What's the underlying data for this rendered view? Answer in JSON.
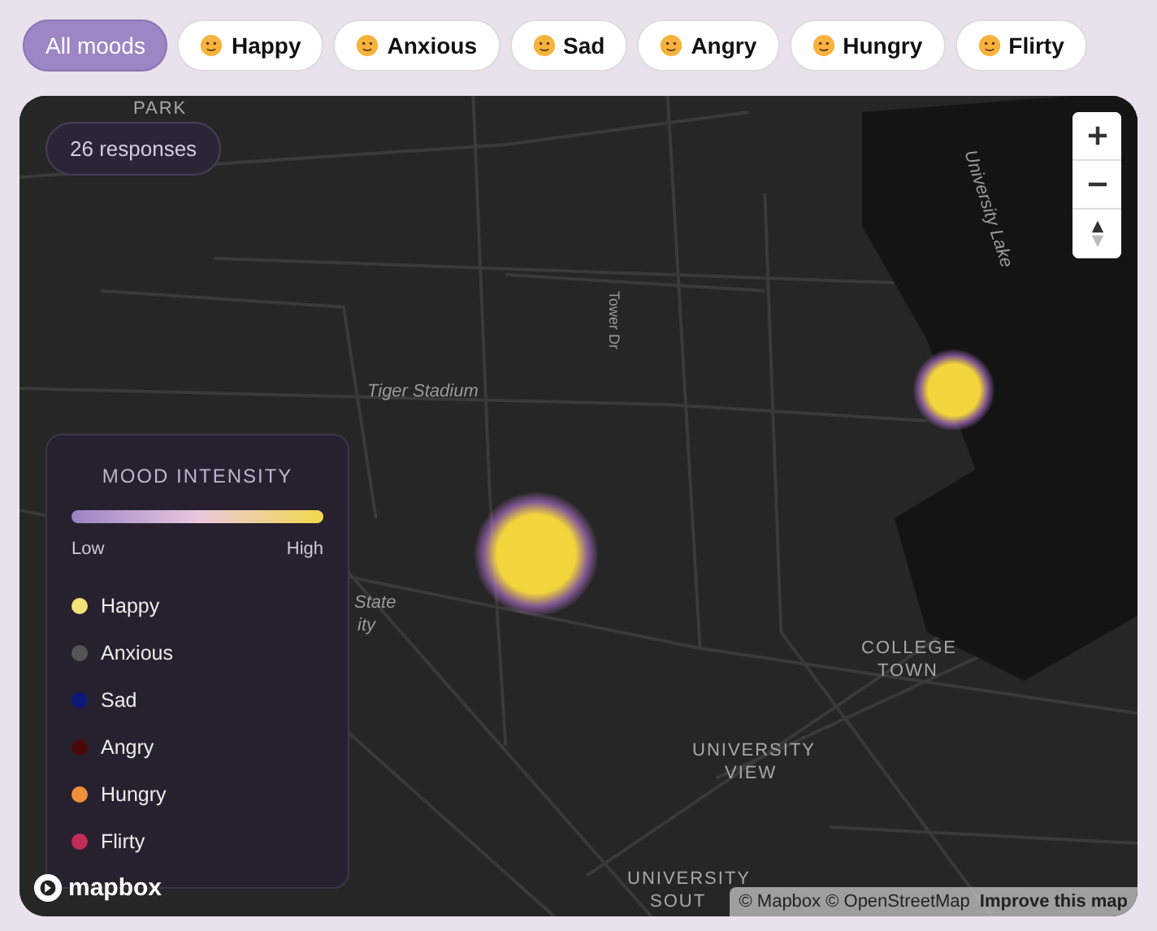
{
  "filters": [
    {
      "label": "All moods",
      "selected": true
    },
    {
      "label": "Happy",
      "selected": false
    },
    {
      "label": "Anxious",
      "selected": false
    },
    {
      "label": "Sad",
      "selected": false
    },
    {
      "label": "Angry",
      "selected": false
    },
    {
      "label": "Hungry",
      "selected": false
    },
    {
      "label": "Flirty",
      "selected": false
    }
  ],
  "map": {
    "response_count": "26 responses",
    "labels": [
      {
        "text": "PARK",
        "kind": "area"
      },
      {
        "text": "Tiger Stadium",
        "kind": "place"
      },
      {
        "text": "Tower Dr",
        "kind": "road"
      },
      {
        "text": "University Lake",
        "kind": "water"
      },
      {
        "text": "State",
        "kind": "place"
      },
      {
        "text": "ity",
        "kind": "place"
      },
      {
        "text": "COLLEGE",
        "kind": "area"
      },
      {
        "text": "TOWN",
        "kind": "area"
      },
      {
        "text": "UNIVERSITY",
        "kind": "area"
      },
      {
        "text": "VIEW",
        "kind": "area"
      },
      {
        "text": "UNIVERSITY",
        "kind": "area"
      },
      {
        "text": "SOUT",
        "kind": "area"
      }
    ],
    "zoom_controls": [
      {
        "kind": "plus"
      },
      {
        "kind": "minus"
      },
      {
        "kind": "compass"
      }
    ],
    "attribution": {
      "text": "© Mapbox © OpenStreetMap",
      "link": "Improve this map"
    },
    "logo": "mapbox"
  },
  "legend": {
    "title": "MOOD INTENSITY",
    "low": "Low",
    "high": "High",
    "items": [
      {
        "label": "Happy",
        "color": "#f5e07a"
      },
      {
        "label": "Anxious",
        "color": "#555555"
      },
      {
        "label": "Sad",
        "color": "#0d1a7a"
      },
      {
        "label": "Angry",
        "color": "#4a0a0a"
      },
      {
        "label": "Hungry",
        "color": "#f0913a"
      },
      {
        "label": "Flirty",
        "color": "#c22c55"
      }
    ]
  }
}
